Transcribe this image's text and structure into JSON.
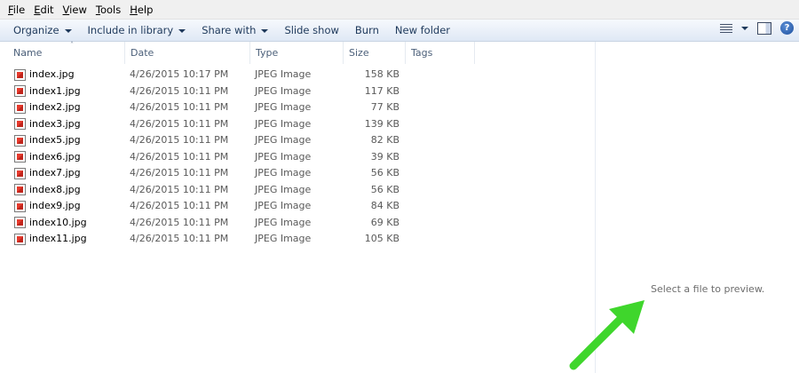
{
  "menu": [
    {
      "accel": "F",
      "rest": "ile"
    },
    {
      "accel": "E",
      "rest": "dit"
    },
    {
      "accel": "V",
      "rest": "iew"
    },
    {
      "accel": "T",
      "rest": "ools"
    },
    {
      "accel": "H",
      "rest": "elp"
    }
  ],
  "toolbar": {
    "organize": "Organize",
    "include_library": "Include in library",
    "share_with": "Share with",
    "slide_show": "Slide show",
    "burn": "Burn",
    "new_folder": "New folder",
    "help": "?"
  },
  "columns": {
    "name": "Name",
    "date": "Date",
    "type": "Type",
    "size": "Size",
    "tags": "Tags"
  },
  "files": [
    {
      "name": "index.jpg",
      "date": "4/26/2015 10:17 PM",
      "type": "JPEG Image",
      "size": "158 KB"
    },
    {
      "name": "index1.jpg",
      "date": "4/26/2015 10:11 PM",
      "type": "JPEG Image",
      "size": "117 KB"
    },
    {
      "name": "index2.jpg",
      "date": "4/26/2015 10:11 PM",
      "type": "JPEG Image",
      "size": "77 KB"
    },
    {
      "name": "index3.jpg",
      "date": "4/26/2015 10:11 PM",
      "type": "JPEG Image",
      "size": "139 KB"
    },
    {
      "name": "index5.jpg",
      "date": "4/26/2015 10:11 PM",
      "type": "JPEG Image",
      "size": "82 KB"
    },
    {
      "name": "index6.jpg",
      "date": "4/26/2015 10:11 PM",
      "type": "JPEG Image",
      "size": "39 KB"
    },
    {
      "name": "index7.jpg",
      "date": "4/26/2015 10:11 PM",
      "type": "JPEG Image",
      "size": "56 KB"
    },
    {
      "name": "index8.jpg",
      "date": "4/26/2015 10:11 PM",
      "type": "JPEG Image",
      "size": "56 KB"
    },
    {
      "name": "index9.jpg",
      "date": "4/26/2015 10:11 PM",
      "type": "JPEG Image",
      "size": "84 KB"
    },
    {
      "name": "index10.jpg",
      "date": "4/26/2015 10:11 PM",
      "type": "JPEG Image",
      "size": "69 KB"
    },
    {
      "name": "index11.jpg",
      "date": "4/26/2015 10:11 PM",
      "type": "JPEG Image",
      "size": "105 KB"
    }
  ],
  "preview": {
    "message": "Select a file to preview."
  },
  "colors": {
    "arrow": "#3fd62c",
    "toolbar_text": "#1e395b"
  }
}
